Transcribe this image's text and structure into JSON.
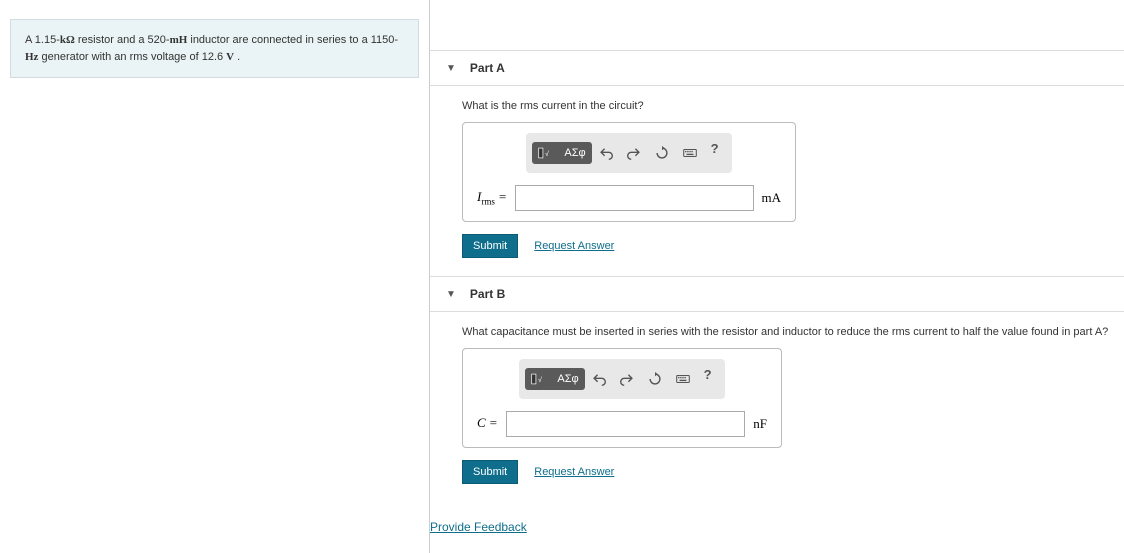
{
  "problem": {
    "text_prefix": "A 1.15-",
    "unit1": "kΩ",
    "text_mid1": " resistor and a 520-",
    "unit2": "mH",
    "text_mid2": " inductor are connected in series to a 1150-",
    "unit3": "Hz",
    "text_mid3": " generator with an rms voltage of 12.6 ",
    "unit4": "V",
    "text_suffix": " ."
  },
  "parts": [
    {
      "title": "Part A",
      "question": "What is the rms current in the circuit?",
      "var_html": "I_rms",
      "var_prefix": "I",
      "var_sub": "rms",
      "equals": " = ",
      "unit": "mA",
      "submit": "Submit",
      "request": "Request Answer"
    },
    {
      "title": "Part B",
      "question": "What capacitance must be inserted in series with the resistor and inductor to reduce the rms current to half the value found in part A?",
      "var_prefix": "C",
      "var_sub": "",
      "equals": " = ",
      "unit": "nF",
      "submit": "Submit",
      "request": "Request Answer"
    }
  ],
  "toolbar": {
    "templates": "▯√▯",
    "greek": "ΑΣφ",
    "help": "?"
  },
  "feedback": "Provide Feedback"
}
